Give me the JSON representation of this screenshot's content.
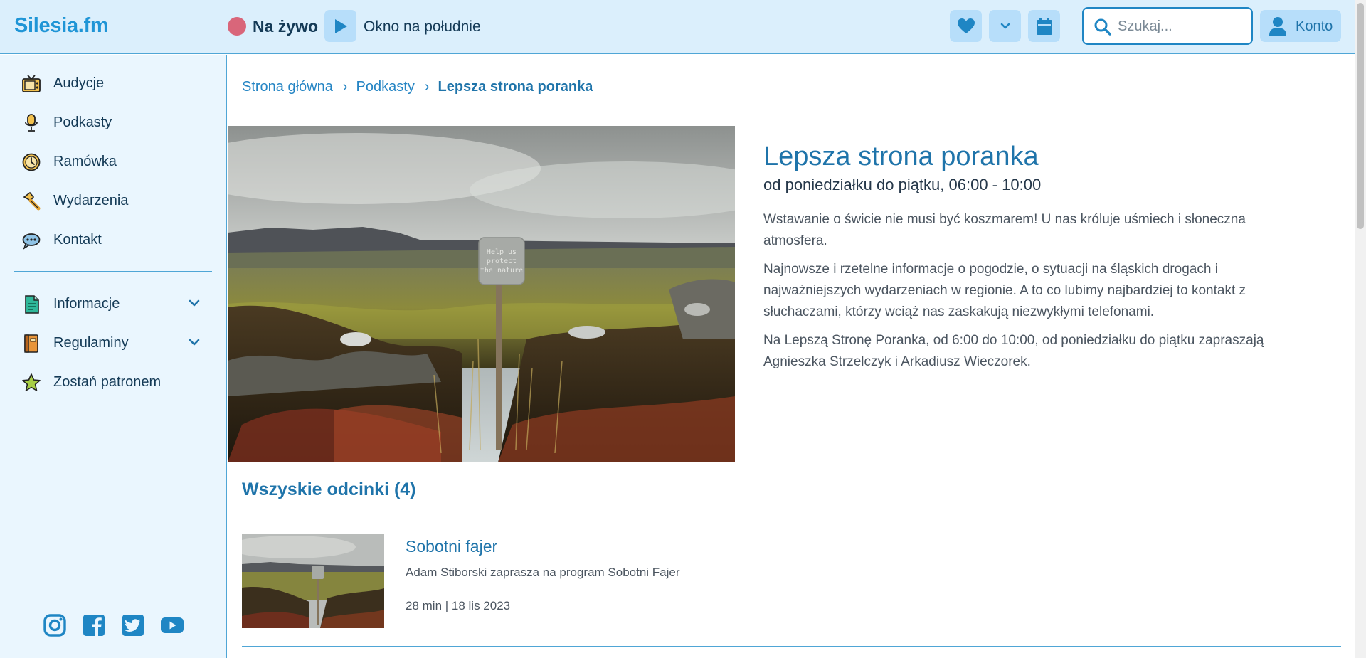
{
  "header": {
    "logo": "Silesia.fm",
    "live_label": "Na żywo",
    "now_playing": "Okno na południe",
    "search_placeholder": "Szukaj...",
    "account_label": "Konto",
    "accent_color": "#1f95d6",
    "live_dot_color": "#d9667a",
    "icons": [
      "play-icon",
      "heart-icon",
      "chevron-down-icon",
      "calendar-icon",
      "search-icon",
      "user-icon"
    ]
  },
  "sidebar": {
    "items": [
      {
        "label": "Audycje",
        "icon": "tv-icon"
      },
      {
        "label": "Podkasty",
        "icon": "microphone-icon"
      },
      {
        "label": "Ramówka",
        "icon": "clock-icon"
      },
      {
        "label": "Wydarzenia",
        "icon": "pin-icon"
      },
      {
        "label": "Kontakt",
        "icon": "speech-bubble-icon"
      }
    ],
    "sections": [
      {
        "label": "Informacje",
        "icon": "document-icon",
        "expandable": true
      },
      {
        "label": "Regulaminy",
        "icon": "book-icon",
        "expandable": true
      },
      {
        "label": "Zostań patronem",
        "icon": "star-icon",
        "expandable": false
      }
    ],
    "social": [
      "instagram-icon",
      "facebook-icon",
      "twitter-icon",
      "youtube-icon"
    ]
  },
  "breadcrumb": {
    "home": "Strona główna",
    "section": "Podkasty",
    "current": "Lepsza strona poranka"
  },
  "show": {
    "title": "Lepsza strona poranka",
    "schedule": "od poniedziałku do piątku, 06:00 - 10:00",
    "paragraphs": [
      "Wstawanie o świcie nie musi być koszmarem! U nas króluje uśmiech i słoneczna atmosfera.",
      "Najnowsze i rzetelne informacje o pogodzie, o sytuacji na śląskich drogach i najważniejszych wydarzeniach w regionie. A to co lubimy najbardziej to kontakt z słuchaczami, którzy wciąż nas zaskakują niezwykłymi telefonami.",
      "Na Lepszą Stronę Poranka, od 6:00 do 10:00, od poniedziałku do piątku zapraszają Agnieszka Strzelczyk i Arkadiusz Wieczorek."
    ],
    "image_sign_text": "Help us protect the nature"
  },
  "episodes": {
    "heading": "Wszyskie odcinki (4)",
    "items": [
      {
        "title": "Sobotni fajer",
        "description": "Adam Stiborski zaprasza na program Sobotni Fajer",
        "meta": "28 min | 18 lis 2023"
      }
    ]
  }
}
